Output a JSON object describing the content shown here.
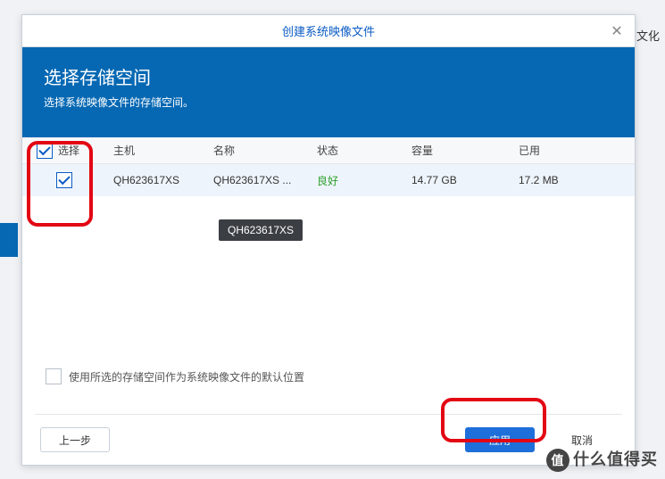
{
  "dialog": {
    "title": "创建系统映像文件",
    "close_glyph": "✕"
  },
  "banner": {
    "title": "选择存储空间",
    "subtitle": "选择系统映像文件的存储空间。"
  },
  "table": {
    "headers": {
      "select": "选择",
      "host": "主机",
      "name": "名称",
      "status": "状态",
      "capacity": "容量",
      "used": "已用"
    },
    "rows": [
      {
        "checked": true,
        "host": "QH623617XS",
        "name": "QH623617XS ...",
        "status": "良好",
        "capacity": "14.77 GB",
        "used": "17.2 MB"
      }
    ]
  },
  "tooltip": "QH623617XS",
  "default_location_label": "使用所选的存储空间作为系统映像文件的默认位置",
  "buttons": {
    "back": "上一步",
    "apply": "应用",
    "cancel": "取消"
  },
  "side_label": "文化",
  "watermark": "什么值得买"
}
